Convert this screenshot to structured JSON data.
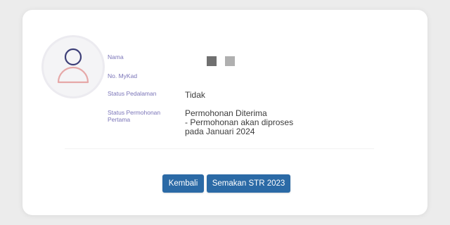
{
  "profile": {
    "fields": [
      {
        "label": "Nama",
        "value": ""
      },
      {
        "label": "No. MyKad",
        "value": ""
      },
      {
        "label": "Status Pedalaman",
        "value": "Tidak"
      },
      {
        "label": "Status Permohonan Pertama",
        "value_lines": [
          "Permohonan Diterima",
          "- Permohonan akan diproses",
          "pada Januari 2024"
        ]
      }
    ]
  },
  "buttons": {
    "back_label": "Kembali",
    "check_label": "Semakan STR 2023"
  },
  "colors": {
    "accent": "#2b6aa6",
    "label": "#7a74b8",
    "avatar_head": "#3d3f78",
    "avatar_body": "#e6a8a8"
  },
  "icons": {
    "avatar": "user-avatar-icon"
  }
}
